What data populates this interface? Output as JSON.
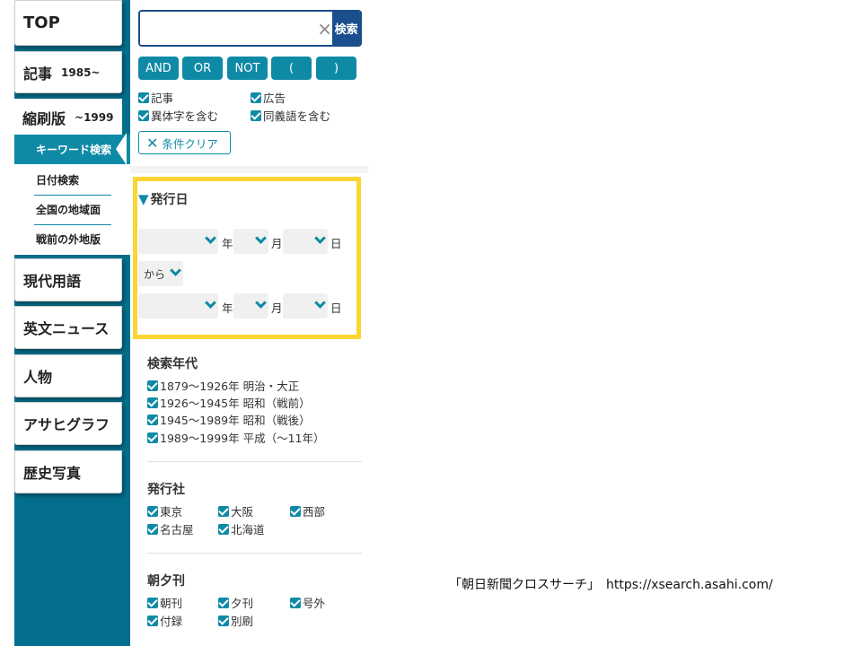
{
  "nav": {
    "top": "TOP",
    "kiji": "記事",
    "kiji_sub": "1985~",
    "shukusatsu": "縮刷版",
    "shukusatsu_sub": "~1999",
    "sub_items": [
      "キーワード検索",
      "日付検索",
      "全国の地域面",
      "戦前の外地版"
    ],
    "gendai": "現代用語",
    "eibun": "英文ニュース",
    "jinbutsu": "人物",
    "asahi_graph": "アサヒグラフ",
    "rekishi": "歴史写真"
  },
  "search": {
    "value": "",
    "clear_icon": "×",
    "button": "検索",
    "operators": [
      "AND",
      "OR",
      "NOT",
      "(",
      ")"
    ]
  },
  "options": {
    "kiji": "記事",
    "koukoku": "広告",
    "itaiji": "異体字を含む",
    "dougigo": "同義語を含む"
  },
  "reset_label": "条件クリア",
  "date": {
    "title": "発行日",
    "year_unit": "年",
    "month_unit": "月",
    "day_unit": "日",
    "range_word": "から"
  },
  "eras": {
    "title": "検索年代",
    "items": [
      "1879〜1926年 明治・大正",
      "1926〜1945年 昭和（戦前）",
      "1945〜1989年 昭和（戦後）",
      "1989〜1999年 平成（〜11年）"
    ]
  },
  "publisher": {
    "title": "発行社",
    "items": [
      "東京",
      "大阪",
      "西部",
      "名古屋",
      "北海道"
    ]
  },
  "edition": {
    "title": "朝夕刊",
    "items": [
      "朝刊",
      "夕刊",
      "号外",
      "付録",
      "別刷"
    ]
  },
  "footer": "「朝日新聞クロスサーチ」　https://xsearch.asahi.com/",
  "colors": {
    "sidebar": "#046f8c",
    "accent": "#0f8aa6",
    "search_button": "#1a4e8c",
    "highlight_frame": "#fcd535"
  }
}
